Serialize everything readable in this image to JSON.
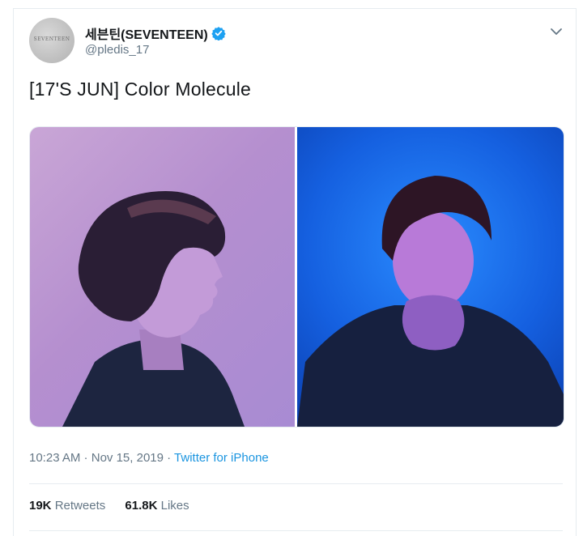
{
  "author": {
    "display_name": "세븐틴(SEVENTEEN)",
    "handle": "@pledis_17",
    "avatar_text": "SEVENTEEN",
    "verified": true
  },
  "tweet": {
    "text": "[17'S JUN] Color Molecule",
    "time": "10:23 AM",
    "separator": " · ",
    "date": "Nov 15, 2019",
    "source": "Twitter for iPhone"
  },
  "stats": {
    "retweets_count": "19K",
    "retweets_label": "Retweets",
    "likes_count": "61.8K",
    "likes_label": "Likes"
  },
  "icons": {
    "verified": "verified-badge-icon",
    "more": "chevron-down-icon"
  },
  "colors": {
    "link": "#1b95e0",
    "secondary_text": "#657786",
    "verified": "#1da1f2",
    "border": "#e6ecf0"
  }
}
